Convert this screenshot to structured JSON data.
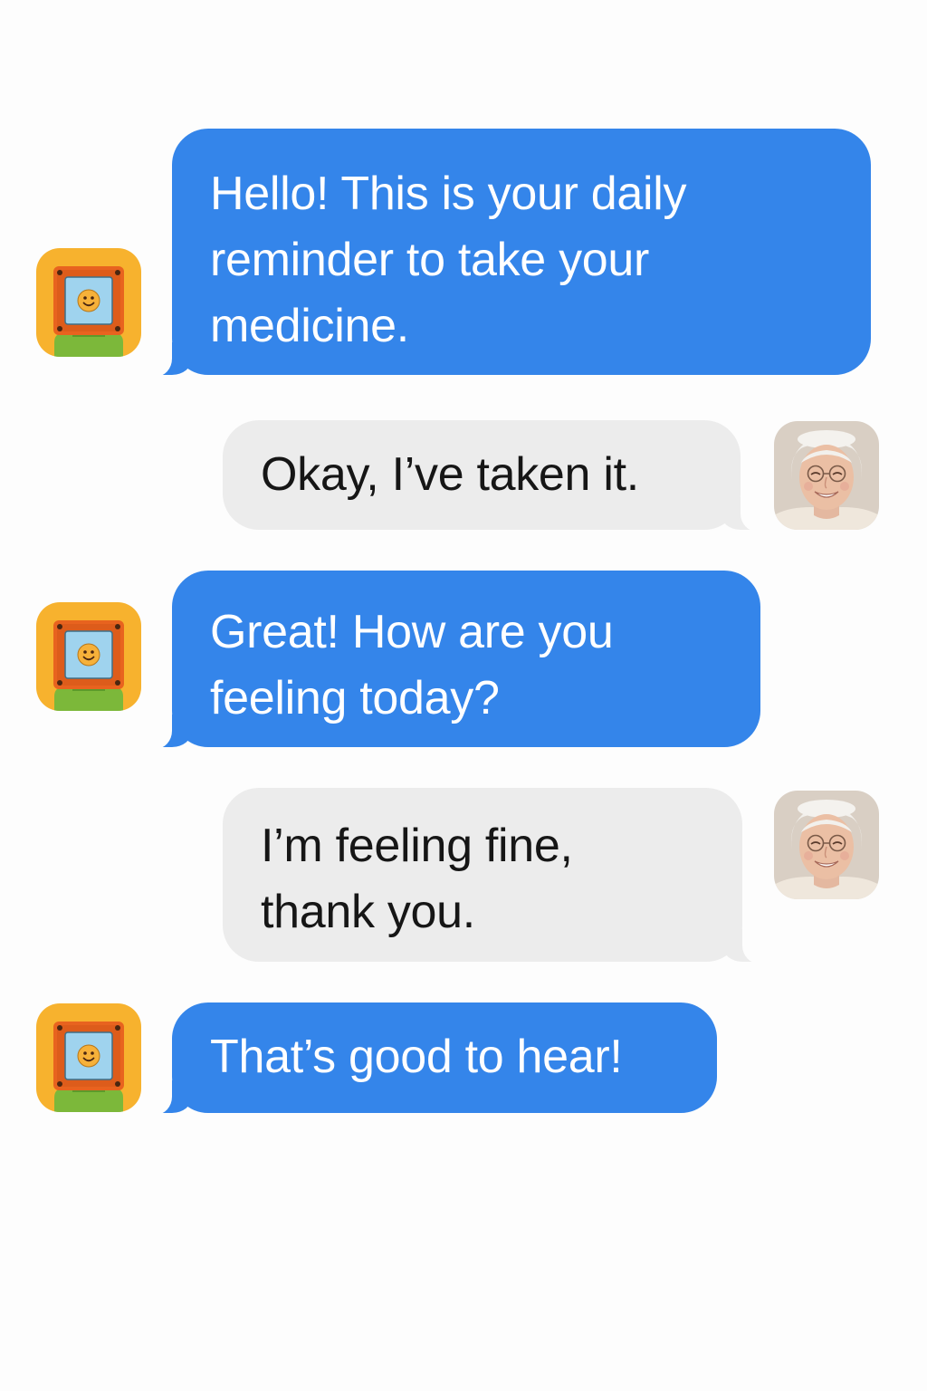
{
  "conversation": {
    "messages": [
      {
        "sender": "bot",
        "avatar_icon": "robot-avatar-icon",
        "text": "Hello! This is your daily reminder to take your medicine."
      },
      {
        "sender": "user",
        "avatar_icon": "elderly-woman-avatar",
        "text": "Okay, I’ve taken it."
      },
      {
        "sender": "bot",
        "avatar_icon": "robot-avatar-icon",
        "text": "Great! How are you feeling today?"
      },
      {
        "sender": "user",
        "avatar_icon": "elderly-woman-avatar",
        "text": "I’m feeling fine, thank you."
      },
      {
        "sender": "bot",
        "avatar_icon": "robot-avatar-icon",
        "text": "That’s good to hear!"
      }
    ]
  },
  "colors": {
    "bot_bubble": "#3485ea",
    "bot_text": "#ffffff",
    "user_bubble": "#ececec",
    "user_text": "#161616",
    "background": "#fdfdfd",
    "robot_avatar_bg": "#f7b22e",
    "robot_frame": "#e8631f",
    "robot_screen": "#9fd3ee",
    "robot_body": "#7cb83a"
  }
}
